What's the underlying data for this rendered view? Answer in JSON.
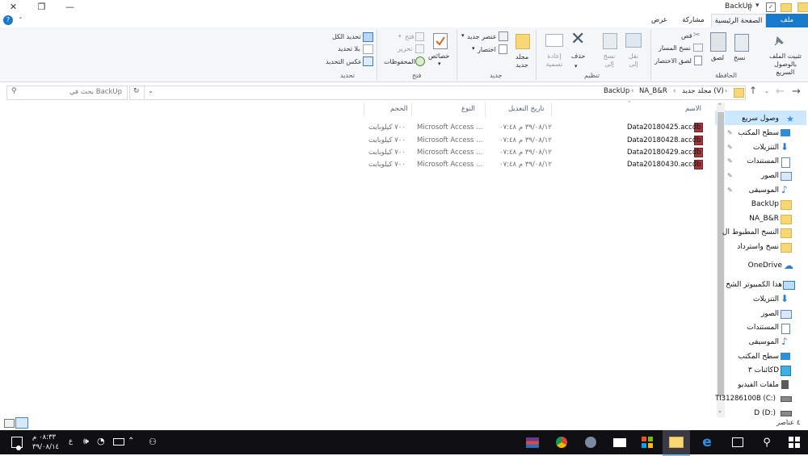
{
  "window": {
    "title": "BackUp",
    "minimize_glyph": "—",
    "maximize_glyph": "❐",
    "close_glyph": "✕"
  },
  "tabs": [
    "ملف",
    "الصفحة الرئيسية",
    "مشاركة",
    "عرض"
  ],
  "ribbon": {
    "clipboard": {
      "pin": "تثبيت الملف بالوصول السريع",
      "copy": "نسخ",
      "paste": "لصق",
      "cut": "قص",
      "copy_path": "نسخ المسار",
      "paste_shortcut": "لصق الاختصار",
      "group": "الحافظة"
    },
    "organize": {
      "move_to": "نقل إلى",
      "copy_to": "نسخ إلى",
      "delete": "حذف",
      "rename": "إعادة تسمية",
      "group": "تنظيم"
    },
    "new": {
      "new_folder": "مجلد جديد",
      "new_item": "عنصر جديد",
      "easy_access": "اختصار",
      "group": "جديد"
    },
    "open": {
      "properties": "خصائص",
      "open": "فتح",
      "edit": "تحرير",
      "history": "المحفوظات",
      "group": "فتح"
    },
    "select": {
      "select_all": "تحديد الكل",
      "select_none": "بلا تحديد",
      "invert": "عكس التحديد",
      "group": "تحديد"
    }
  },
  "address": {
    "crumbs": [
      "مجلد جديد (V)",
      "NA_B&R",
      "BackUp"
    ],
    "search_placeholder": "بحث في BackUp"
  },
  "nav": {
    "quick_access": "وصول سريع",
    "items": [
      {
        "label": "سطح المكتب",
        "icon": "desktop-icon"
      },
      {
        "label": "التنزيلات",
        "icon": "download-icon"
      },
      {
        "label": "المستندات",
        "icon": "documents-icon"
      },
      {
        "label": "الصور",
        "icon": "pictures-icon"
      },
      {
        "label": "الموسيقى",
        "icon": "music-icon"
      },
      {
        "label": "BackUp",
        "icon": "folder-icon"
      },
      {
        "label": "NA_B&R",
        "icon": "folder-icon"
      },
      {
        "label": "النسخ المطبوط ال",
        "icon": "folder-icon"
      },
      {
        "label": "نسخ واسترداد",
        "icon": "folder-icon"
      },
      {
        "label": "OneDrive",
        "icon": "cloud-icon"
      },
      {
        "label": "هذا الكمبيوتر الشخ",
        "icon": "computer-icon"
      },
      {
        "label": "التنزيلات",
        "icon": "download-icon"
      },
      {
        "label": "الصور",
        "icon": "pictures-icon"
      },
      {
        "label": "المستندات",
        "icon": "documents-icon"
      },
      {
        "label": "الموسيقى",
        "icon": "music-icon"
      },
      {
        "label": "سطح المكتب",
        "icon": "desktop-icon"
      },
      {
        "label": "كائنات ٣D",
        "icon": "3d-objects-icon"
      },
      {
        "label": "ملفات الفيديو",
        "icon": "videos-icon"
      },
      {
        "label": "TI31286100B (C:)",
        "icon": "drive-c-icon"
      },
      {
        "label": "D (D:)",
        "icon": "drive-d-icon"
      }
    ]
  },
  "columns": [
    "الاسم",
    "تاريخ التعديل",
    "النوع",
    "الحجم"
  ],
  "files": [
    {
      "name": "Data20180425.accdb",
      "date": "٣٩/٠٨/١٢ م ٠٧:٤٨",
      "type": "Microsoft Access ...",
      "size": "٧٠٠ كيلوبايت"
    },
    {
      "name": "Data20180428.accdb",
      "date": "٣٩/٠٨/١٢ م ٠٧:٤٨",
      "type": "Microsoft Access ...",
      "size": "٧٠٠ كيلوبايت"
    },
    {
      "name": "Data20180429.accdb",
      "date": "٣٩/٠٨/١٢ م ٠٧:٤٨",
      "type": "Microsoft Access ...",
      "size": "٧٠٠ كيلوبايت"
    },
    {
      "name": "Data20180430.accdb",
      "date": "٣٩/٠٨/١٢ م ٠٧:٤٨",
      "type": "Microsoft Access ...",
      "size": "٧٠٠ كيلوبايت"
    }
  ],
  "status": {
    "count": "٤ عناصر"
  },
  "taskbar": {
    "time": "٠٨:٣٣ م",
    "date": "٣٩/٠٨/١٤",
    "lang": "ع"
  },
  "colors": {
    "accent": "#1979ca",
    "taskbar": "#0f0f14",
    "folder": "#f7d675"
  }
}
